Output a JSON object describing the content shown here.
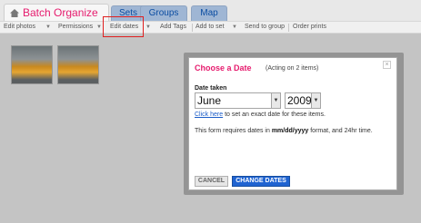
{
  "app": {
    "title": "Batch Organize"
  },
  "tabs": [
    {
      "label": "Sets"
    },
    {
      "label": "Groups"
    },
    {
      "label": "Map"
    }
  ],
  "toolbar": {
    "items": [
      {
        "label": "Edit photos"
      },
      {
        "label": "Permissions"
      },
      {
        "label": "Edit dates"
      },
      {
        "label": "Add Tags"
      },
      {
        "label": "Add to set"
      },
      {
        "label": "Send to group"
      },
      {
        "label": "Order prints"
      }
    ]
  },
  "dialog": {
    "heading": "Choose a Date",
    "acting_on": "(Acting on 2 items)",
    "date_taken_label": "Date taken",
    "month": "June",
    "year": "2009",
    "exact_link": "Click here",
    "exact_text": " to set an exact date for these items.",
    "format_note_pre": "This form requires dates in ",
    "format_note_bold": "mm/dd/yyyy",
    "format_note_post": " format, and 24hr time.",
    "cancel_label": "CANCEL",
    "change_label": "CHANGE DATES",
    "close_glyph": "×"
  },
  "icons": {
    "dropdown_arrow": "▼"
  },
  "colors": {
    "accent_pink": "#e61c6e",
    "primary_blue": "#1f63d1",
    "highlight_red": "#e02020"
  }
}
